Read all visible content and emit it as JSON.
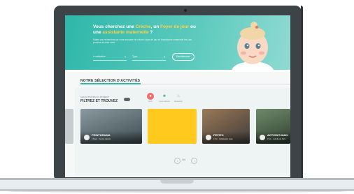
{
  "hero": {
    "title_part1": "Vous cherchez une ",
    "title_highlight1": "Crèche",
    "title_part2": ", un ",
    "title_highlight2": "Foyer de jour",
    "title_part3": " ou",
    "title_part4": "une ",
    "title_highlight3": "assistante maternelle",
    "title_part5": " ?",
    "description": "Faites vos recherches sur notre annuaire de crèche, foyer de jour et d'assistante maternelle les plus proches de chez vous.",
    "select_location": "Localisation",
    "select_type": "Type",
    "search_button": "Rechercher",
    "colors": {
      "gradient_start": "#2fb7a9",
      "highlight": "#ffd24a"
    }
  },
  "selection": {
    "title": "NOTRE SÉLECTION D'ACTIVITÉS"
  },
  "filters": {
    "kicker": "LES ACTIVITÉS DU MOMENT",
    "title": "FILTREZ ET TROUVEZ",
    "categories": [
      {
        "label": "Sport",
        "icon": "ball-icon",
        "active": true
      },
      {
        "label": "Lieux culturels",
        "icon": "tree-icon",
        "active": false
      },
      {
        "label": "Restaurant",
        "icon": "cup-icon",
        "active": false
      }
    ]
  },
  "cards": [
    {
      "name": "",
      "subtitle": "",
      "icon": "activity-logo-icon"
    },
    {
      "name": "PEINTURAMA",
      "subtitle": "2 Mars · Centre culturel",
      "icon": "activity-logo-icon"
    },
    {
      "name": "",
      "subtitle": "",
      "icon": ""
    },
    {
      "name": "PEPITO",
      "subtitle": "2 Km · Réalisation Faire",
      "icon": "activity-logo-icon"
    },
    {
      "name": "ACTION'S MAN",
      "subtitle": "3 Km · Activité du Parc",
      "icon": "activity-logo-icon"
    }
  ],
  "pager": {
    "current": "1/4"
  }
}
